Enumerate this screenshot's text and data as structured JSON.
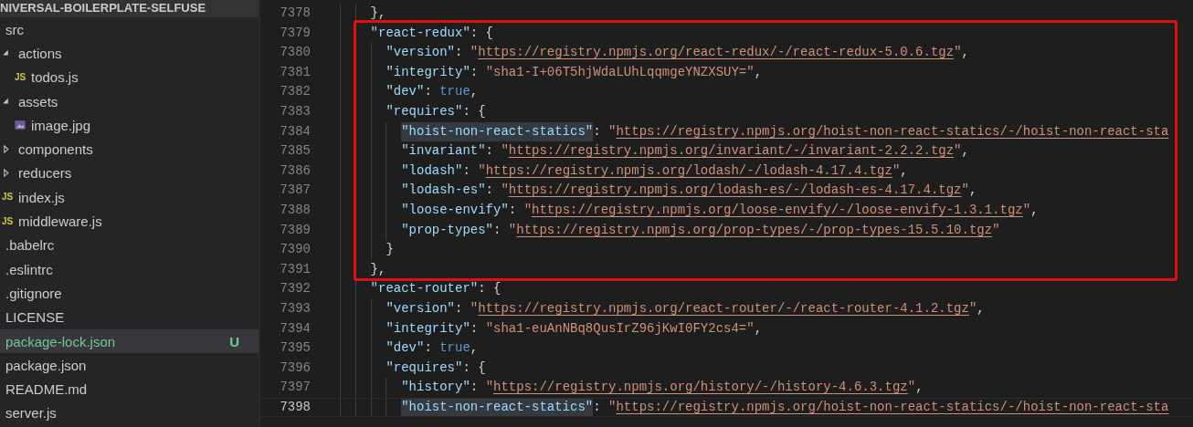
{
  "explorer": {
    "title": "NIVERSAL-BOILERPLATE-SELFUSE",
    "items": [
      {
        "label": "src",
        "selected": false,
        "children": [
          {
            "label": "actions",
            "kind": "folder",
            "expanded": true,
            "selected": false,
            "children": [
              {
                "label": "todos.js",
                "kind": "js",
                "icon_label": "JS",
                "selected": false
              }
            ]
          },
          {
            "label": "assets",
            "kind": "folder",
            "expanded": true,
            "selected": false,
            "children": [
              {
                "label": "image.jpg",
                "kind": "image",
                "selected": false
              }
            ]
          },
          {
            "label": "components",
            "kind": "folder",
            "expanded": false,
            "selected": false
          },
          {
            "label": "reducers",
            "kind": "folder",
            "expanded": false,
            "selected": false
          },
          {
            "label": "index.js",
            "kind": "js",
            "icon_label": "JS",
            "selected": false
          },
          {
            "label": "middleware.js",
            "kind": "js",
            "icon_label": "JS",
            "selected": false
          }
        ]
      },
      {
        "label": ".babelrc",
        "selected": false
      },
      {
        "label": ".eslintrc",
        "selected": false
      },
      {
        "label": ".gitignore",
        "selected": false
      },
      {
        "label": "LICENSE",
        "selected": false
      },
      {
        "label": "package-lock.json",
        "selected": true,
        "status": "U",
        "color": "#73c991"
      },
      {
        "label": "package.json",
        "selected": false
      },
      {
        "label": "README.md",
        "selected": false
      },
      {
        "label": "server.js",
        "selected": false
      }
    ]
  },
  "editor": {
    "lines": [
      {
        "number": "7378",
        "framed": false,
        "current": false,
        "tokens": [
          {
            "kind": "punct",
            "text": "},"
          }
        ]
      },
      {
        "number": "7379",
        "framed": true,
        "current": false,
        "tokens": [
          {
            "kind": "key",
            "text": "\"react-redux\""
          },
          {
            "kind": "punct",
            "text": ": {"
          }
        ],
        "children": [
          {
            "number": "7380",
            "current": false,
            "tokens": [
              {
                "kind": "key",
                "text": "\"version\""
              },
              {
                "kind": "punct",
                "text": ": "
              },
              {
                "kind": "string",
                "text": "\""
              },
              {
                "kind": "url",
                "text": "https://registry.npmjs.org/react-redux/-/react-redux-5.0.6.tgz"
              },
              {
                "kind": "string",
                "text": "\""
              },
              {
                "kind": "punct",
                "text": ","
              }
            ]
          },
          {
            "number": "7381",
            "current": false,
            "tokens": [
              {
                "kind": "key",
                "text": "\"integrity\""
              },
              {
                "kind": "punct",
                "text": ": "
              },
              {
                "kind": "string",
                "text": "\"sha1-I+06T5hjWdaLUhLqqmgeYNZXSUY=\""
              },
              {
                "kind": "punct",
                "text": ","
              }
            ]
          },
          {
            "number": "7382",
            "current": false,
            "tokens": [
              {
                "kind": "key",
                "text": "\"dev\""
              },
              {
                "kind": "punct",
                "text": ": "
              },
              {
                "kind": "keyword",
                "text": "true"
              },
              {
                "kind": "punct",
                "text": ","
              }
            ]
          },
          {
            "number": "7383",
            "current": false,
            "tokens": [
              {
                "kind": "key",
                "text": "\"requires\""
              },
              {
                "kind": "punct",
                "text": ": {"
              }
            ],
            "children": [
              {
                "number": "7384",
                "current": false,
                "tokens": [
                  {
                    "kind": "key-match",
                    "text": "\"hoist-non-react-statics\""
                  },
                  {
                    "kind": "punct",
                    "text": ": "
                  },
                  {
                    "kind": "string",
                    "text": "\""
                  },
                  {
                    "kind": "url",
                    "text": "https://registry.npmjs.org/hoist-non-react-statics/-/hoist-non-react-sta"
                  }
                ]
              },
              {
                "number": "7385",
                "current": false,
                "tokens": [
                  {
                    "kind": "key",
                    "text": "\"invariant\""
                  },
                  {
                    "kind": "punct",
                    "text": ": "
                  },
                  {
                    "kind": "string",
                    "text": "\""
                  },
                  {
                    "kind": "url",
                    "text": "https://registry.npmjs.org/invariant/-/invariant-2.2.2.tgz"
                  },
                  {
                    "kind": "string",
                    "text": "\""
                  },
                  {
                    "kind": "punct",
                    "text": ","
                  }
                ]
              },
              {
                "number": "7386",
                "current": false,
                "tokens": [
                  {
                    "kind": "key",
                    "text": "\"lodash\""
                  },
                  {
                    "kind": "punct",
                    "text": ": "
                  },
                  {
                    "kind": "string",
                    "text": "\""
                  },
                  {
                    "kind": "url",
                    "text": "https://registry.npmjs.org/lodash/-/lodash-4.17.4.tgz"
                  },
                  {
                    "kind": "string",
                    "text": "\""
                  },
                  {
                    "kind": "punct",
                    "text": ","
                  }
                ]
              },
              {
                "number": "7387",
                "current": false,
                "tokens": [
                  {
                    "kind": "key",
                    "text": "\"lodash-es\""
                  },
                  {
                    "kind": "punct",
                    "text": ": "
                  },
                  {
                    "kind": "string",
                    "text": "\""
                  },
                  {
                    "kind": "url",
                    "text": "https://registry.npmjs.org/lodash-es/-/lodash-es-4.17.4.tgz"
                  },
                  {
                    "kind": "string",
                    "text": "\""
                  },
                  {
                    "kind": "punct",
                    "text": ","
                  }
                ]
              },
              {
                "number": "7388",
                "current": false,
                "tokens": [
                  {
                    "kind": "key",
                    "text": "\"loose-envify\""
                  },
                  {
                    "kind": "punct",
                    "text": ": "
                  },
                  {
                    "kind": "string",
                    "text": "\""
                  },
                  {
                    "kind": "url",
                    "text": "https://registry.npmjs.org/loose-envify/-/loose-envify-1.3.1.tgz"
                  },
                  {
                    "kind": "string",
                    "text": "\""
                  },
                  {
                    "kind": "punct",
                    "text": ","
                  }
                ]
              },
              {
                "number": "7389",
                "current": false,
                "tokens": [
                  {
                    "kind": "key",
                    "text": "\"prop-types\""
                  },
                  {
                    "kind": "punct",
                    "text": ": "
                  },
                  {
                    "kind": "string",
                    "text": "\""
                  },
                  {
                    "kind": "url",
                    "text": "https://registry.npmjs.org/prop-types/-/prop-types-15.5.10.tgz"
                  },
                  {
                    "kind": "string",
                    "text": "\""
                  }
                ]
              }
            ],
            "end": {
              "number": "7390",
              "current": false,
              "tokens": [
                {
                  "kind": "punct",
                  "text": "}"
                }
              ]
            }
          }
        ],
        "end": {
          "number": "7391",
          "current": false,
          "tokens": [
            {
              "kind": "punct",
              "text": "},"
            }
          ]
        }
      },
      {
        "number": "7392",
        "framed": false,
        "current": false,
        "tokens": [
          {
            "kind": "key",
            "text": "\"react-router\""
          },
          {
            "kind": "punct",
            "text": ": {"
          }
        ],
        "children": [
          {
            "number": "7393",
            "current": false,
            "tokens": [
              {
                "kind": "key",
                "text": "\"version\""
              },
              {
                "kind": "punct",
                "text": ": "
              },
              {
                "kind": "string",
                "text": "\""
              },
              {
                "kind": "url",
                "text": "https://registry.npmjs.org/react-router/-/react-router-4.1.2.tgz"
              },
              {
                "kind": "string",
                "text": "\""
              },
              {
                "kind": "punct",
                "text": ","
              }
            ]
          },
          {
            "number": "7394",
            "current": false,
            "tokens": [
              {
                "kind": "key",
                "text": "\"integrity\""
              },
              {
                "kind": "punct",
                "text": ": "
              },
              {
                "kind": "string",
                "text": "\"sha1-euAnNBq8QusIrZ96jKwI0FY2cs4=\""
              },
              {
                "kind": "punct",
                "text": ","
              }
            ]
          },
          {
            "number": "7395",
            "current": false,
            "tokens": [
              {
                "kind": "key",
                "text": "\"dev\""
              },
              {
                "kind": "punct",
                "text": ": "
              },
              {
                "kind": "keyword",
                "text": "true"
              },
              {
                "kind": "punct",
                "text": ","
              }
            ]
          },
          {
            "number": "7396",
            "current": false,
            "tokens": [
              {
                "kind": "key",
                "text": "\"requires\""
              },
              {
                "kind": "punct",
                "text": ": {"
              }
            ],
            "children": [
              {
                "number": "7397",
                "current": false,
                "tokens": [
                  {
                    "kind": "key",
                    "text": "\"history\""
                  },
                  {
                    "kind": "punct",
                    "text": ": "
                  },
                  {
                    "kind": "string",
                    "text": "\""
                  },
                  {
                    "kind": "url",
                    "text": "https://registry.npmjs.org/history/-/history-4.6.3.tgz"
                  },
                  {
                    "kind": "string",
                    "text": "\""
                  },
                  {
                    "kind": "punct",
                    "text": ","
                  }
                ]
              },
              {
                "number": "7398",
                "current": true,
                "tokens": [
                  {
                    "kind": "key-match",
                    "text": "\"hoist-non-react-statics\""
                  },
                  {
                    "kind": "punct",
                    "text": ": "
                  },
                  {
                    "kind": "string",
                    "text": "\""
                  },
                  {
                    "kind": "url",
                    "text": "https://registry.npmjs.org/hoist-non-react-statics/-/hoist-non-react-sta"
                  }
                ]
              }
            ]
          }
        ]
      }
    ]
  }
}
